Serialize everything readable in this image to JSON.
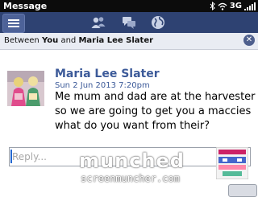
{
  "status_bar": {
    "title": "Message",
    "network": "3G",
    "icons": [
      "bluetooth-icon",
      "wifi-icon",
      "signal-icon"
    ]
  },
  "toolbar": {
    "icons": [
      "menu-icon",
      "contacts-icon",
      "chats-icon",
      "globe-icon"
    ]
  },
  "conversation_header": {
    "prefix": "Between",
    "you": "You",
    "and": "and",
    "contact": "Maria Lee Slater"
  },
  "message": {
    "sender": "Maria Lee Slater",
    "timestamp": "Sun 2 Jun 2013 7:20pm",
    "text": "Me mum and dad are at the harvester so we are going to get you a maccies what do you want from their?"
  },
  "reply": {
    "placeholder": "Reply..."
  },
  "watermark": {
    "line1": "munched",
    "line2": "screenmuncher.com"
  },
  "colors": {
    "toolbar": "#2e4272",
    "accent": "#3c5a99",
    "status_bar": "#0c0c0c"
  }
}
